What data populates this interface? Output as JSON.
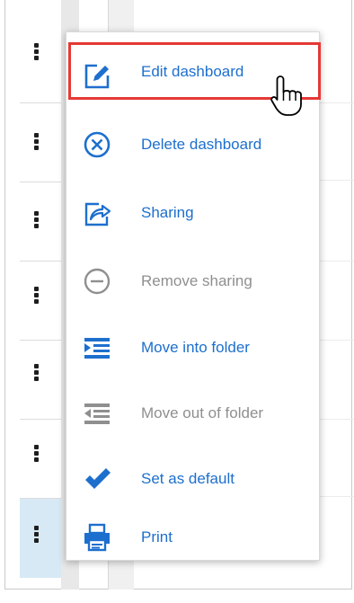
{
  "menu": {
    "items": [
      {
        "label": "Edit dashboard",
        "icon": "edit-icon",
        "enabled": true
      },
      {
        "label": "Delete dashboard",
        "icon": "delete-circle-icon",
        "enabled": true
      },
      {
        "label": "Sharing",
        "icon": "share-icon",
        "enabled": true
      },
      {
        "label": "Remove sharing",
        "icon": "remove-circle-icon",
        "enabled": false
      },
      {
        "label": "Move into folder",
        "icon": "indent-icon",
        "enabled": true
      },
      {
        "label": "Move out of folder",
        "icon": "outdent-icon",
        "enabled": false
      },
      {
        "label": "Set as default",
        "icon": "checkmark-icon",
        "enabled": true
      },
      {
        "label": "Print",
        "icon": "printer-icon",
        "enabled": true
      }
    ],
    "highlighted_item": "Edit dashboard"
  },
  "rows": {
    "count": 7,
    "selected_index": 6
  },
  "colors": {
    "accent": "#1d6fce",
    "disabled": "#8f8f8f",
    "highlight": "#e53935",
    "selected_row": "#d7e9f5"
  },
  "cursor": "hand-pointer-icon"
}
